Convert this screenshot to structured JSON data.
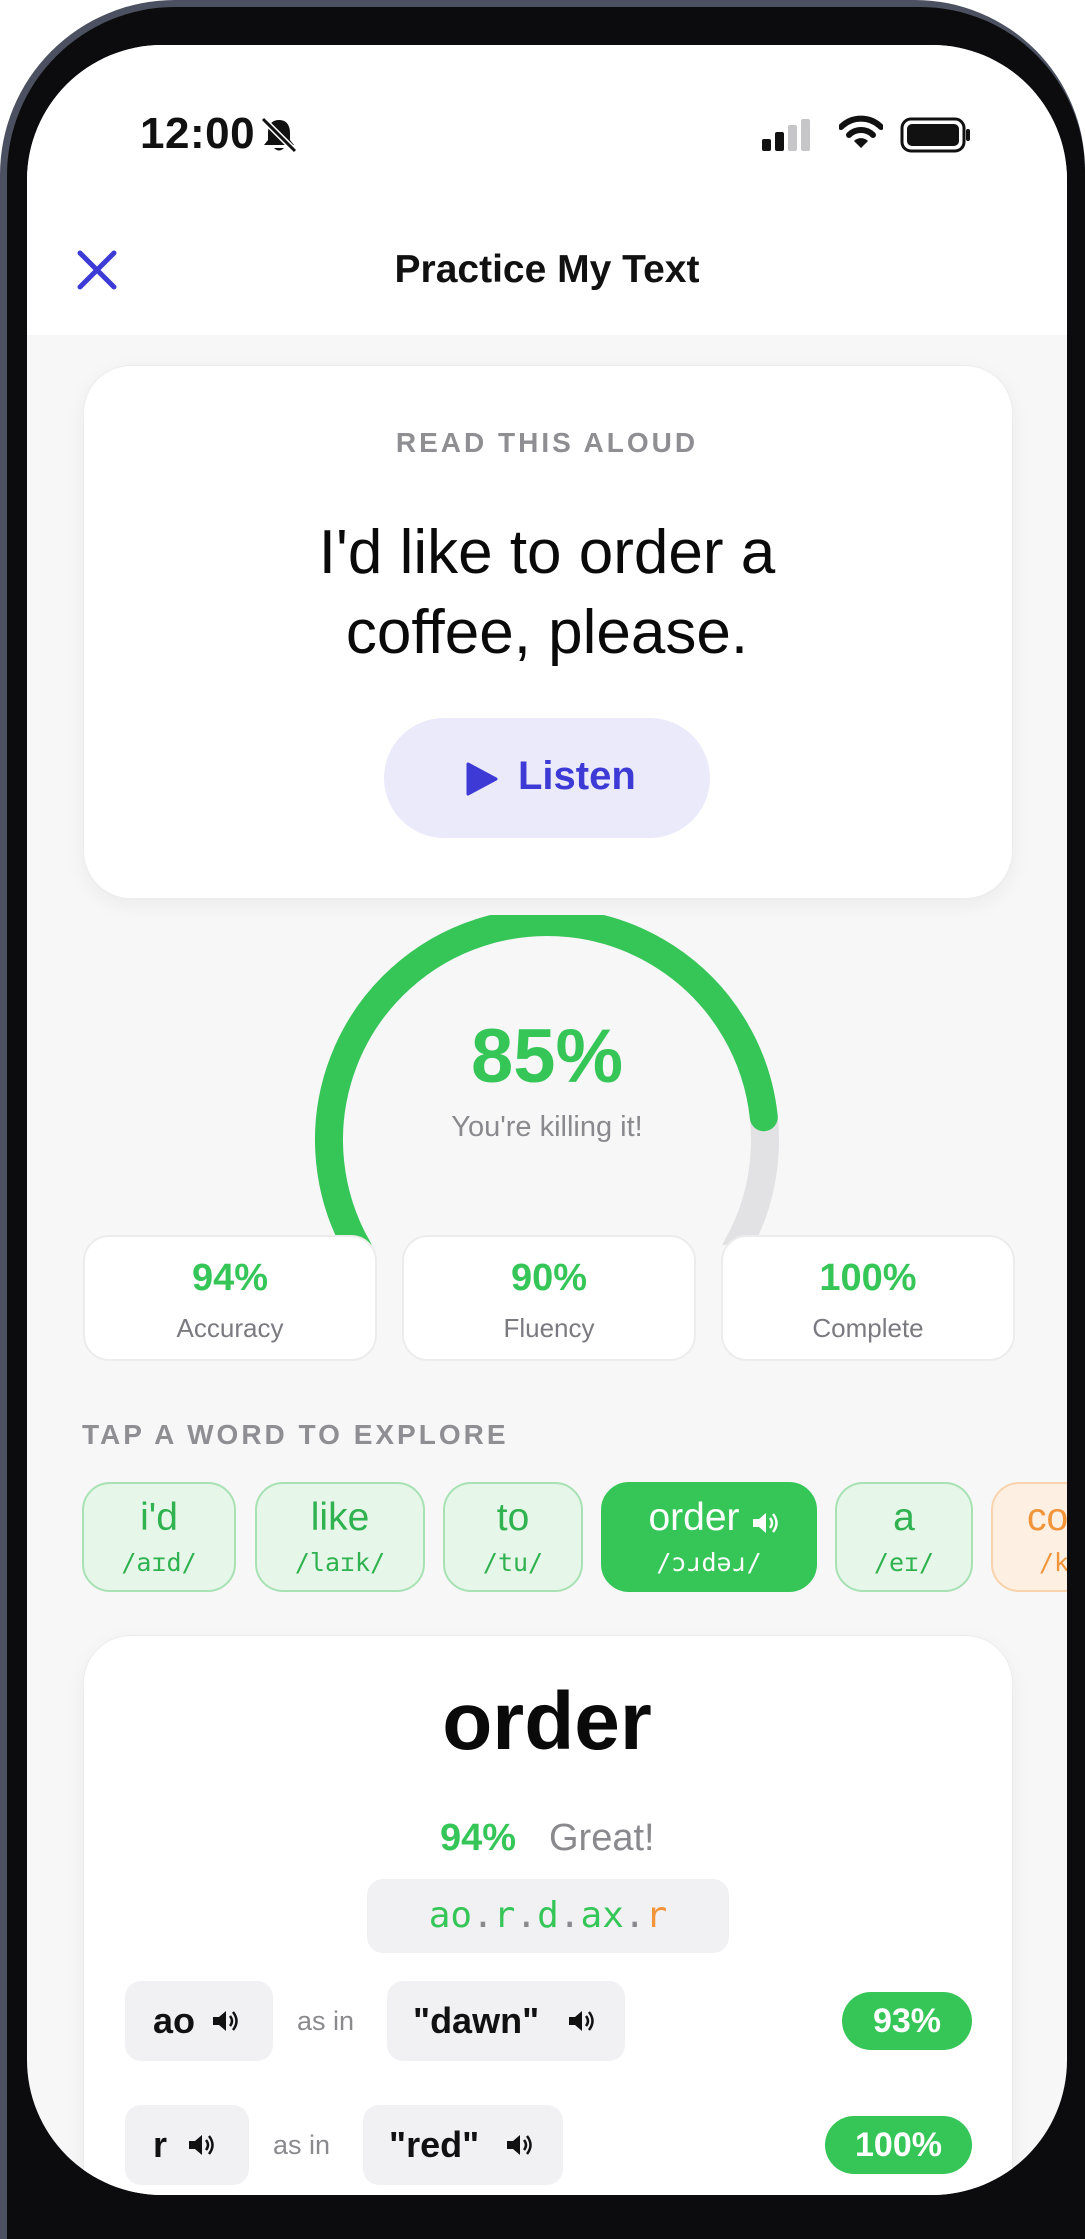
{
  "status_bar": {
    "time": "12:00"
  },
  "header": {
    "title": "Practice My Text"
  },
  "prompt": {
    "label": "READ THIS ALOUD",
    "line1": "I'd like to order a",
    "line2": "coffee, please.",
    "listen_label": "Listen"
  },
  "score": {
    "value": "85%",
    "fraction": 0.85,
    "caption": "You're killing it!"
  },
  "metrics": [
    {
      "value": "94%",
      "label": "Accuracy"
    },
    {
      "value": "90%",
      "label": "Fluency"
    },
    {
      "value": "100%",
      "label": "Complete"
    }
  ],
  "words_section": {
    "label": "TAP A WORD TO EXPLORE",
    "words": [
      {
        "word": "i'd",
        "ipa": "/aɪd/"
      },
      {
        "word": "like",
        "ipa": "/laɪk/"
      },
      {
        "word": "to",
        "ipa": "/tu/"
      },
      {
        "word": "order",
        "ipa": "/ɔɹdəɹ/",
        "selected": true
      },
      {
        "word": "a",
        "ipa": "/eɪ/"
      },
      {
        "word": "co",
        "ipa": "/k"
      }
    ]
  },
  "detail": {
    "word": "order",
    "score": "94%",
    "rating": "Great!",
    "phonemes": [
      "ao",
      "r",
      "d",
      "ax",
      "r"
    ],
    "rows": [
      {
        "phoneme": "ao",
        "as_in": "as in",
        "example": "\"dawn\"",
        "score": "93%"
      },
      {
        "phoneme": "r",
        "as_in": "as in",
        "example": "\"red\"",
        "score": "100%"
      }
    ]
  },
  "colors": {
    "accent": "#3d3ad6",
    "good": "#36c658",
    "warn": "#f2943a",
    "track": "#e2e2e4"
  },
  "icons": [
    "bell-slash-icon",
    "signal-icon",
    "wifi-icon",
    "battery-icon",
    "close-icon",
    "play-icon",
    "speaker-icon"
  ]
}
